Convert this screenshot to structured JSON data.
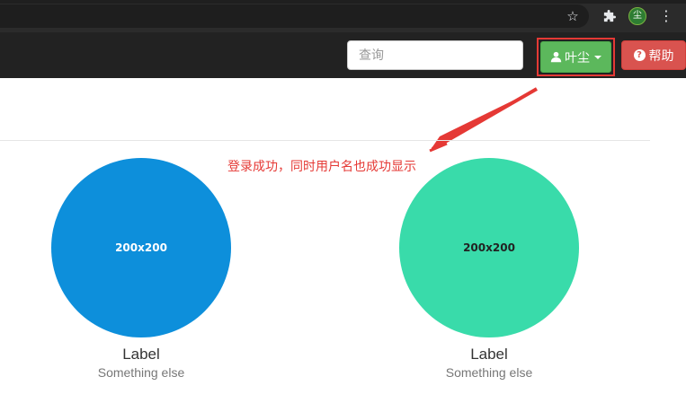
{
  "browser": {
    "icons": {
      "star": "star-icon",
      "extensions": "puzzle-icon",
      "profile": "尘",
      "menu": "kebab-menu-icon"
    }
  },
  "navbar": {
    "search": {
      "placeholder": "查询",
      "value": ""
    },
    "user_button": {
      "label": "叶尘",
      "icon": "user-icon",
      "color": "#5cb85c"
    },
    "help_button": {
      "label": "帮助",
      "icon": "question-circle-icon",
      "color": "#d9534f"
    },
    "highlight_color": "#e53935"
  },
  "annotation": {
    "text": "登录成功，同时用户名也成功显示",
    "color": "#e53935"
  },
  "thumbnails": [
    {
      "image_text": "200x200",
      "label": "Label",
      "caption": "Something else",
      "color": "#0d8fdb"
    },
    {
      "image_text": "200x200",
      "label": "Label",
      "caption": "Something else",
      "color": "#39dbaa"
    }
  ]
}
